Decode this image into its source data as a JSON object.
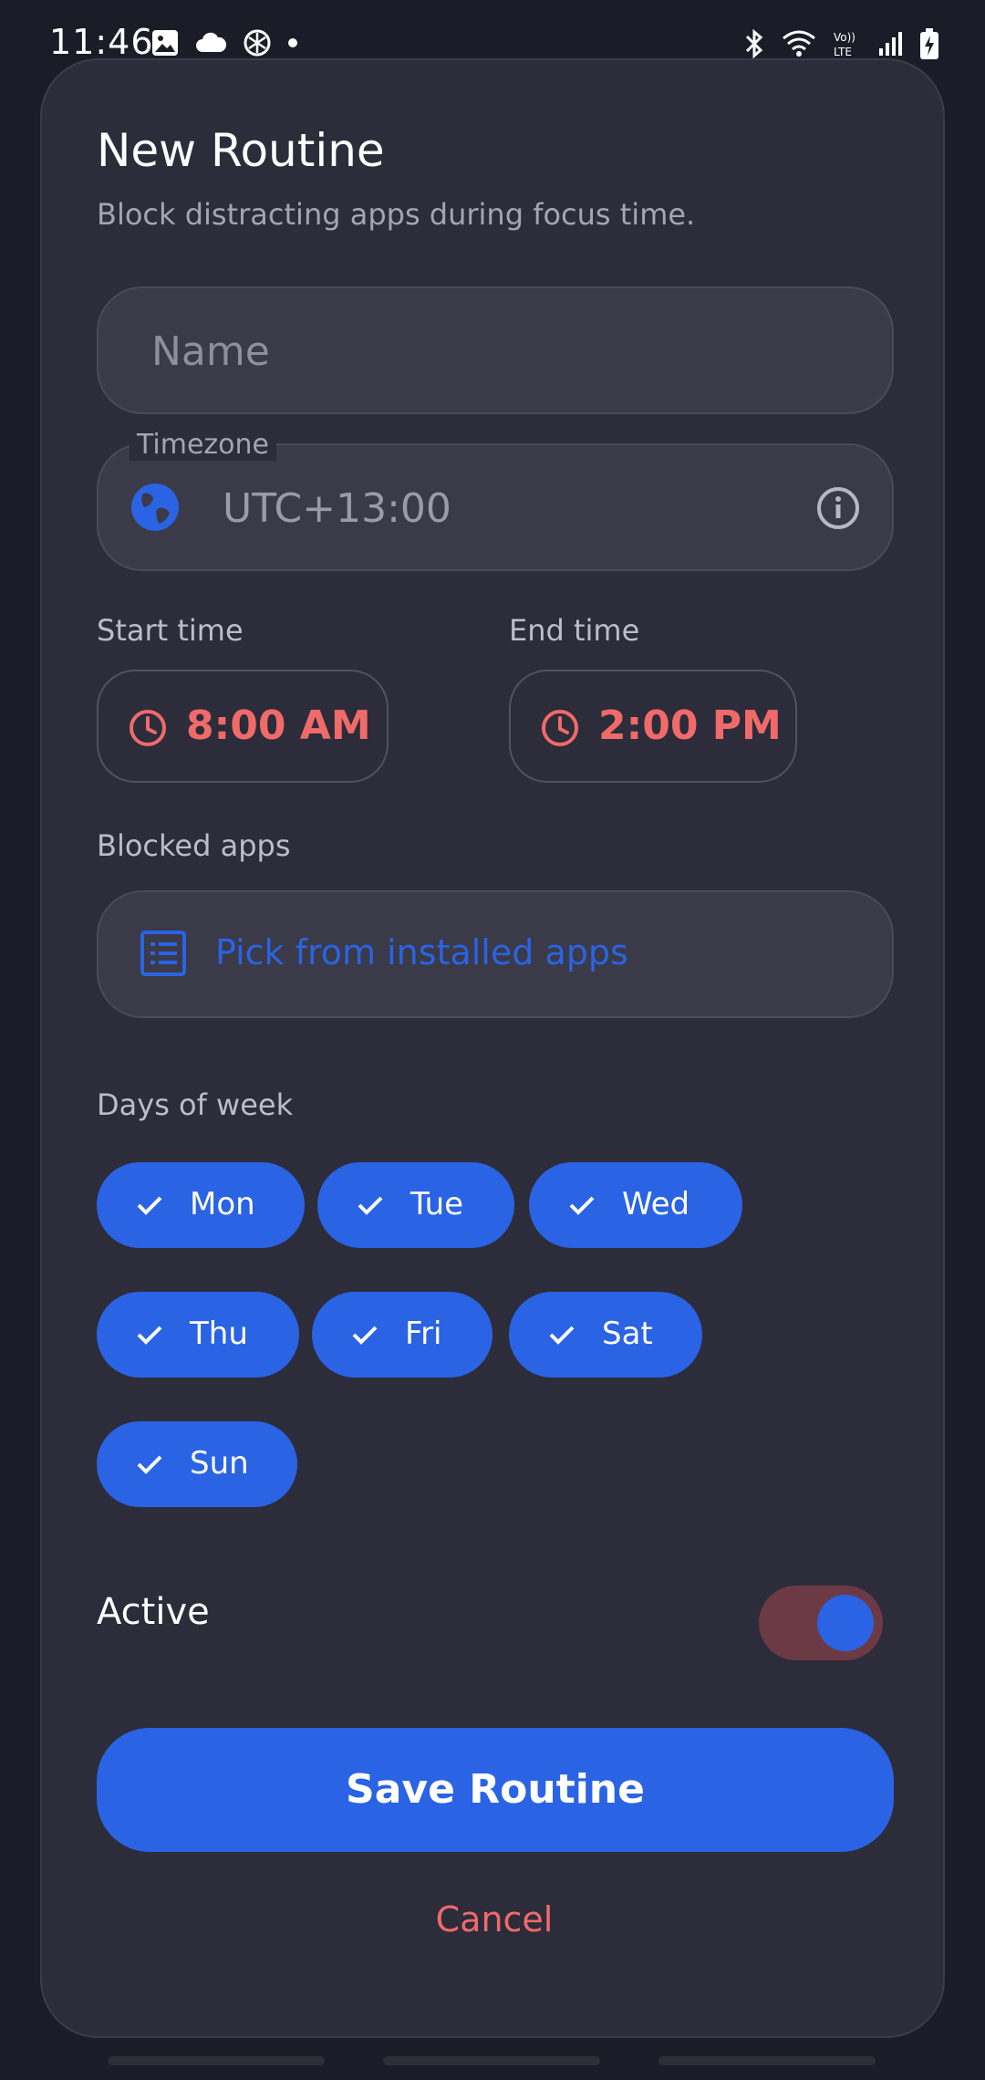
{
  "status_bar": {
    "time": "11:46"
  },
  "dialog": {
    "title": "New Routine",
    "subtitle": "Block distracting apps during focus time.",
    "name_field": {
      "placeholder": "Name",
      "value": ""
    },
    "timezone": {
      "label": "Timezone",
      "value": "UTC+13:00",
      "icon": "globe-icon"
    },
    "start_time": {
      "label": "Start time",
      "value": "8:00 AM"
    },
    "end_time": {
      "label": "End time",
      "value": "2:00 PM"
    },
    "blocked_apps": {
      "label": "Blocked apps",
      "button_label": "Pick from installed apps"
    },
    "days": {
      "label": "Days of week",
      "items": [
        {
          "label": "Mon",
          "selected": true
        },
        {
          "label": "Tue",
          "selected": true
        },
        {
          "label": "Wed",
          "selected": true
        },
        {
          "label": "Thu",
          "selected": true
        },
        {
          "label": "Fri",
          "selected": true
        },
        {
          "label": "Sat",
          "selected": true
        },
        {
          "label": "Sun",
          "selected": true
        }
      ]
    },
    "active": {
      "label": "Active",
      "on": true
    },
    "save_label": "Save Routine",
    "cancel_label": "Cancel"
  },
  "colors": {
    "accent": "#2a63e3",
    "danger": "#f06a6a",
    "card_bg": "#2c2c3a",
    "page_bg": "#1b1c28"
  }
}
